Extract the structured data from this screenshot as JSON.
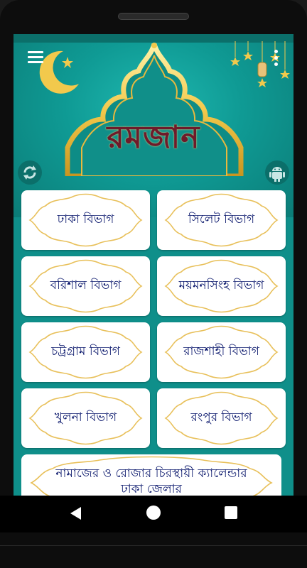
{
  "app": {
    "title": "রমজান"
  },
  "divisions": [
    {
      "label": "ঢাকা বিভাগ"
    },
    {
      "label": "সিলেট বিভাগ"
    },
    {
      "label": "বরিশাল বিভাগ"
    },
    {
      "label": "ময়মনসিংহ বিভাগ"
    },
    {
      "label": "চট্রগ্রাম বিভাগ"
    },
    {
      "label": "রাজশাহী বিভাগ"
    },
    {
      "label": "খুলনা বিভাগ"
    },
    {
      "label": "রংপুর বিভাগ"
    }
  ],
  "calendar_card": {
    "line1": "নামাজের ও রোজার চিরস্থায়ী ক্যালেন্ডার",
    "line2": "ঢাকা জেলার"
  },
  "icons": {
    "menu": "hamburger-menu-icon",
    "more": "more-vert-icon",
    "refresh": "refresh-icon",
    "android": "android-icon",
    "back": "nav-back-icon",
    "home": "nav-home-icon",
    "recent": "nav-recent-icon"
  },
  "colors": {
    "header_teal": "#0f9a94",
    "background_teal": "#0f8f8a",
    "gold": "#f2c94c",
    "title_maroon": "#6e1a2a",
    "label_navy": "#0d1a6e"
  }
}
